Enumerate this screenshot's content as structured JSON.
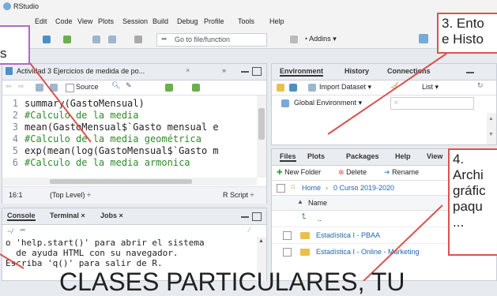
{
  "app": {
    "title": "RStudio"
  },
  "menu": [
    "Edit",
    "Code",
    "View",
    "Plots",
    "Session",
    "Build",
    "Debug",
    "Profile",
    "Tools",
    "Help"
  ],
  "toolbar": {
    "goto_placeholder": "Go to file/function",
    "addins_label": "Addins"
  },
  "editor": {
    "tab_label": "Actividad 3 Ejercicios de medida de po...",
    "source_label": "Source",
    "lines": [
      {
        "n": "1",
        "text": "summary(GastoMensual)",
        "kind": "code"
      },
      {
        "n": "2",
        "text": "#Calculo de la media",
        "kind": "comment"
      },
      {
        "n": "3",
        "text": "mean(GastoMensual$`Gasto mensual e",
        "kind": "code"
      },
      {
        "n": "4",
        "text": "#Calculo de la media geométrica",
        "kind": "comment"
      },
      {
        "n": "5",
        "text": "exp(mean(log(GastoMensual$`Gasto m",
        "kind": "code"
      },
      {
        "n": "6",
        "text": "#Calculo de la media armonica",
        "kind": "comment"
      }
    ],
    "status_pos": "16:1",
    "status_scope": "(Top Level) ÷",
    "status_type": "R Script ÷"
  },
  "console": {
    "tabs": [
      "Console",
      "Terminal ×",
      "Jobs ×"
    ],
    "path": "~/",
    "lines": [
      "o 'help.start()' para abrir el sistema",
      "  de ayuda HTML con su navegador.",
      "Escriba 'q()' para salir de R."
    ]
  },
  "env": {
    "tabs": [
      "Environment",
      "History",
      "Connections"
    ],
    "import_label": "Import Dataset",
    "list_label": "List",
    "global_env_label": "Global Environment"
  },
  "files": {
    "tabs": [
      "Files",
      "Plots",
      "Packages",
      "Help",
      "View"
    ],
    "new_folder_label": "New Folder",
    "delete_label": "Delete",
    "rename_label": "Rename",
    "breadcrumb_home": "Home",
    "breadcrumb_folder": "0 Curso 2019-2020",
    "name_header": "Name",
    "up_label": "..",
    "items": [
      "Estadística I - PBAA",
      "Estadística I - Online - Marketing"
    ]
  },
  "annotations": {
    "left_box": "s",
    "box3": "3. Ento\ne Histo",
    "box4": "4.\nArchi\ngráfic\npaqu\n...",
    "bottom_caption": "CLASES PARTICULARES, TU"
  }
}
